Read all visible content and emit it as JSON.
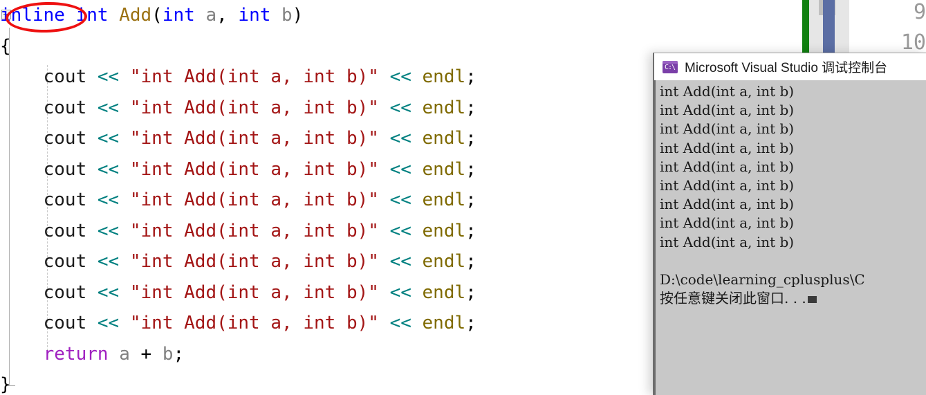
{
  "editor": {
    "collapse_icon": "collapse-minus-icon",
    "code_lines": [
      {
        "indent": 0,
        "tokens": [
          {
            "t": "inline",
            "c": "kw"
          },
          {
            "t": " ",
            "c": "punct"
          },
          {
            "t": "int",
            "c": "kw"
          },
          {
            "t": " ",
            "c": "punct"
          },
          {
            "t": "Add",
            "c": "fn"
          },
          {
            "t": "(",
            "c": "punct"
          },
          {
            "t": "int",
            "c": "kw"
          },
          {
            "t": " ",
            "c": "punct"
          },
          {
            "t": "a",
            "c": "var"
          },
          {
            "t": ", ",
            "c": "punct"
          },
          {
            "t": "int",
            "c": "kw"
          },
          {
            "t": " ",
            "c": "punct"
          },
          {
            "t": "b",
            "c": "var"
          },
          {
            "t": ")",
            "c": "punct"
          }
        ]
      },
      {
        "indent": 0,
        "tokens": [
          {
            "t": "{",
            "c": "punct"
          }
        ]
      },
      {
        "indent": 1,
        "tokens": [
          {
            "t": "cout",
            "c": "id"
          },
          {
            "t": " ",
            "c": "punct"
          },
          {
            "t": "<<",
            "c": "op"
          },
          {
            "t": " ",
            "c": "punct"
          },
          {
            "t": "\"int Add(int a, int b)\"",
            "c": "str"
          },
          {
            "t": " ",
            "c": "punct"
          },
          {
            "t": "<<",
            "c": "op"
          },
          {
            "t": " ",
            "c": "punct"
          },
          {
            "t": "endl",
            "c": "endl"
          },
          {
            "t": ";",
            "c": "punct"
          }
        ]
      },
      {
        "indent": 1,
        "tokens": [
          {
            "t": "cout",
            "c": "id"
          },
          {
            "t": " ",
            "c": "punct"
          },
          {
            "t": "<<",
            "c": "op"
          },
          {
            "t": " ",
            "c": "punct"
          },
          {
            "t": "\"int Add(int a, int b)\"",
            "c": "str"
          },
          {
            "t": " ",
            "c": "punct"
          },
          {
            "t": "<<",
            "c": "op"
          },
          {
            "t": " ",
            "c": "punct"
          },
          {
            "t": "endl",
            "c": "endl"
          },
          {
            "t": ";",
            "c": "punct"
          }
        ]
      },
      {
        "indent": 1,
        "tokens": [
          {
            "t": "cout",
            "c": "id"
          },
          {
            "t": " ",
            "c": "punct"
          },
          {
            "t": "<<",
            "c": "op"
          },
          {
            "t": " ",
            "c": "punct"
          },
          {
            "t": "\"int Add(int a, int b)\"",
            "c": "str"
          },
          {
            "t": " ",
            "c": "punct"
          },
          {
            "t": "<<",
            "c": "op"
          },
          {
            "t": " ",
            "c": "punct"
          },
          {
            "t": "endl",
            "c": "endl"
          },
          {
            "t": ";",
            "c": "punct"
          }
        ]
      },
      {
        "indent": 1,
        "tokens": [
          {
            "t": "cout",
            "c": "id"
          },
          {
            "t": " ",
            "c": "punct"
          },
          {
            "t": "<<",
            "c": "op"
          },
          {
            "t": " ",
            "c": "punct"
          },
          {
            "t": "\"int Add(int a, int b)\"",
            "c": "str"
          },
          {
            "t": " ",
            "c": "punct"
          },
          {
            "t": "<<",
            "c": "op"
          },
          {
            "t": " ",
            "c": "punct"
          },
          {
            "t": "endl",
            "c": "endl"
          },
          {
            "t": ";",
            "c": "punct"
          }
        ]
      },
      {
        "indent": 1,
        "tokens": [
          {
            "t": "cout",
            "c": "id"
          },
          {
            "t": " ",
            "c": "punct"
          },
          {
            "t": "<<",
            "c": "op"
          },
          {
            "t": " ",
            "c": "punct"
          },
          {
            "t": "\"int Add(int a, int b)\"",
            "c": "str"
          },
          {
            "t": " ",
            "c": "punct"
          },
          {
            "t": "<<",
            "c": "op"
          },
          {
            "t": " ",
            "c": "punct"
          },
          {
            "t": "endl",
            "c": "endl"
          },
          {
            "t": ";",
            "c": "punct"
          }
        ]
      },
      {
        "indent": 1,
        "tokens": [
          {
            "t": "cout",
            "c": "id"
          },
          {
            "t": " ",
            "c": "punct"
          },
          {
            "t": "<<",
            "c": "op"
          },
          {
            "t": " ",
            "c": "punct"
          },
          {
            "t": "\"int Add(int a, int b)\"",
            "c": "str"
          },
          {
            "t": " ",
            "c": "punct"
          },
          {
            "t": "<<",
            "c": "op"
          },
          {
            "t": " ",
            "c": "punct"
          },
          {
            "t": "endl",
            "c": "endl"
          },
          {
            "t": ";",
            "c": "punct"
          }
        ]
      },
      {
        "indent": 1,
        "tokens": [
          {
            "t": "cout",
            "c": "id"
          },
          {
            "t": " ",
            "c": "punct"
          },
          {
            "t": "<<",
            "c": "op"
          },
          {
            "t": " ",
            "c": "punct"
          },
          {
            "t": "\"int Add(int a, int b)\"",
            "c": "str"
          },
          {
            "t": " ",
            "c": "punct"
          },
          {
            "t": "<<",
            "c": "op"
          },
          {
            "t": " ",
            "c": "punct"
          },
          {
            "t": "endl",
            "c": "endl"
          },
          {
            "t": ";",
            "c": "punct"
          }
        ]
      },
      {
        "indent": 1,
        "tokens": [
          {
            "t": "cout",
            "c": "id"
          },
          {
            "t": " ",
            "c": "punct"
          },
          {
            "t": "<<",
            "c": "op"
          },
          {
            "t": " ",
            "c": "punct"
          },
          {
            "t": "\"int Add(int a, int b)\"",
            "c": "str"
          },
          {
            "t": " ",
            "c": "punct"
          },
          {
            "t": "<<",
            "c": "op"
          },
          {
            "t": " ",
            "c": "punct"
          },
          {
            "t": "endl",
            "c": "endl"
          },
          {
            "t": ";",
            "c": "punct"
          }
        ]
      },
      {
        "indent": 1,
        "tokens": [
          {
            "t": "cout",
            "c": "id"
          },
          {
            "t": " ",
            "c": "punct"
          },
          {
            "t": "<<",
            "c": "op"
          },
          {
            "t": " ",
            "c": "punct"
          },
          {
            "t": "\"int Add(int a, int b)\"",
            "c": "str"
          },
          {
            "t": " ",
            "c": "punct"
          },
          {
            "t": "<<",
            "c": "op"
          },
          {
            "t": " ",
            "c": "punct"
          },
          {
            "t": "endl",
            "c": "endl"
          },
          {
            "t": ";",
            "c": "punct"
          }
        ]
      },
      {
        "indent": 1,
        "tokens": [
          {
            "t": "return",
            "c": "kwp"
          },
          {
            "t": " ",
            "c": "punct"
          },
          {
            "t": "a",
            "c": "var"
          },
          {
            "t": " ",
            "c": "punct"
          },
          {
            "t": "+",
            "c": "punct"
          },
          {
            "t": " ",
            "c": "punct"
          },
          {
            "t": "b",
            "c": "var"
          },
          {
            "t": ";",
            "c": "punct"
          }
        ]
      },
      {
        "indent": 0,
        "tokens": [
          {
            "t": "}",
            "c": "punct"
          }
        ]
      }
    ],
    "annotation": {
      "shape": "ellipse",
      "color": "#ee1111",
      "targets_text": "inline"
    }
  },
  "right_panel": {
    "scrollbar_changebar_color": "#108010",
    "scrollbar_thumb_color": "#5b6ea4",
    "hint_numbers": "9\n10"
  },
  "console": {
    "title": "Microsoft Visual Studio 调试控制台",
    "icon": "cmd-console-icon",
    "icon_glyph": "C:\\",
    "output_lines": [
      "int Add(int a, int b)",
      "int Add(int a, int b)",
      "int Add(int a, int b)",
      "int Add(int a, int b)",
      "int Add(int a, int b)",
      "int Add(int a, int b)",
      "int Add(int a, int b)",
      "int Add(int a, int b)",
      "int Add(int a, int b)"
    ],
    "path_line": "D:\\code\\learning_cplusplus\\C",
    "prompt_line": "按任意键关闭此窗口. . .",
    "background": "#c8c8c8",
    "text_color": "#1a1a1a"
  }
}
